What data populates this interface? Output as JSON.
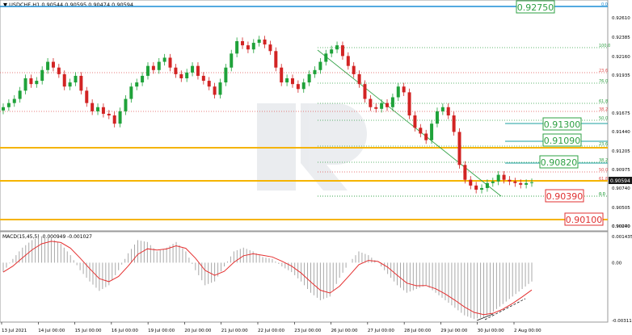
{
  "header": {
    "symbol_label": "USDCHF,H1",
    "ohlc_label": "0.90544 0.90595 0.90474 0.90594"
  },
  "macd_header": "MACD(15,45,5) -0.000949 -0.001027",
  "price_axis": {
    "ticks": [
      "0.92610",
      "0.92385",
      "0.92160",
      "0.91935",
      "0.91905",
      "0.91675",
      "0.91440",
      "0.91205",
      "0.90975",
      "0.90740",
      "0.90505",
      "0.90270",
      "0.90040"
    ],
    "current_price": "0.90594"
  },
  "macd_axis": {
    "ticks": [
      "0.001435",
      "0.00",
      "-0.003117"
    ]
  },
  "time_axis": {
    "labels": [
      "13 Jul 2021",
      "14 Jul 00:00",
      "15 Jul 00:00",
      "16 Jul 00:00",
      "19 Jul 00:00",
      "20 Jul 00:00",
      "21 Jul 00:00",
      "22 Jul 00:00",
      "23 Jul 00:00",
      "26 Jul 00:00",
      "27 Jul 00:00",
      "28 Jul 00:00",
      "29 Jul 00:00",
      "30 Jul 00:00",
      "2 Aug 00:00"
    ]
  },
  "levels": {
    "top_boxed": "0.92750",
    "top_small": "0.0",
    "green_boxes": [
      "0.91300",
      "0.91090",
      "0.90820"
    ],
    "red_boxes": [
      "0.90390",
      "0.90100"
    ]
  },
  "fib_upper": [
    "100.0",
    "76.0",
    "61.8",
    "50.0",
    "38.2",
    "23.6"
  ],
  "fib_lower_left": [
    "23.6",
    "38.2",
    "50.0",
    "61.8"
  ],
  "fib_lower_right": [
    "0.0",
    "61.8",
    "50.0",
    "38.2",
    "23.6",
    "0.0"
  ],
  "colors": {
    "bull": "#1fa23a",
    "bear": "#d22323",
    "blue_line": "#1b8ed6",
    "orange_line": "#f5b400",
    "fib_green": "#2ea043",
    "fib_red": "#e05050",
    "teal_line": "#1a9f9f",
    "macd_signal": "#e53030",
    "macd_hist": "#a8a8a8"
  },
  "chart_data": {
    "type": "candlestick",
    "symbol": "USDCHF",
    "timeframe": "H1",
    "y_range": [
      0.9003,
      0.9276
    ],
    "candles_close": [
      0.915,
      0.9155,
      0.916,
      0.917,
      0.9185,
      0.9178,
      0.9182,
      0.9195,
      0.9205,
      0.9198,
      0.919,
      0.9175,
      0.918,
      0.9188,
      0.917,
      0.9155,
      0.9145,
      0.915,
      0.9142,
      0.914,
      0.913,
      0.9145,
      0.916,
      0.9175,
      0.918,
      0.9188,
      0.92,
      0.9195,
      0.9205,
      0.921,
      0.9198,
      0.919,
      0.9185,
      0.9192,
      0.92,
      0.9188,
      0.9182,
      0.9175,
      0.9165,
      0.918,
      0.9198,
      0.9215,
      0.923,
      0.9225,
      0.922,
      0.9228,
      0.9232,
      0.9226,
      0.9218,
      0.9198,
      0.918,
      0.9185,
      0.9178,
      0.9172,
      0.918,
      0.919,
      0.9195,
      0.9205,
      0.9215,
      0.922,
      0.9225,
      0.9212,
      0.92,
      0.919,
      0.9178,
      0.916,
      0.915,
      0.9148,
      0.9155,
      0.915,
      0.9162,
      0.9175,
      0.9168,
      0.914,
      0.9125,
      0.9118,
      0.911,
      0.913,
      0.9145,
      0.915,
      0.914,
      0.912,
      0.908,
      0.9062,
      0.9055,
      0.905,
      0.9052,
      0.9058,
      0.906,
      0.9068,
      0.9062,
      0.906,
      0.9058,
      0.9056,
      0.9058,
      0.9059
    ],
    "macd_values": [
      -0.0005,
      0.0002,
      0.0008,
      0.0012,
      0.0014,
      0.0013,
      0.001,
      0.0004,
      -0.0004,
      -0.001,
      -0.0015,
      -0.0012,
      -0.0004,
      0.0005,
      0.0012,
      0.0011,
      0.0006,
      0.0008,
      0.0011,
      0.0006,
      -0.0004,
      -0.0012,
      -0.001,
      -0.0002,
      0.0006,
      0.0008,
      0.0006,
      0.0003,
      0.0002,
      -0.0002,
      -0.0005,
      -0.001,
      -0.0016,
      -0.002,
      -0.0018,
      -0.0008,
      0.0,
      0.0006,
      0.0004,
      0.0,
      -0.0006,
      -0.0012,
      -0.0016,
      -0.0014,
      -0.0012,
      -0.0016,
      -0.002,
      -0.0024,
      -0.0028,
      -0.003,
      -0.0029,
      -0.0026,
      -0.0022,
      -0.0018,
      -0.0014,
      -0.001
    ],
    "macd_params": "15,45,5",
    "macd_y_range": [
      -0.003117,
      0.001435
    ]
  }
}
